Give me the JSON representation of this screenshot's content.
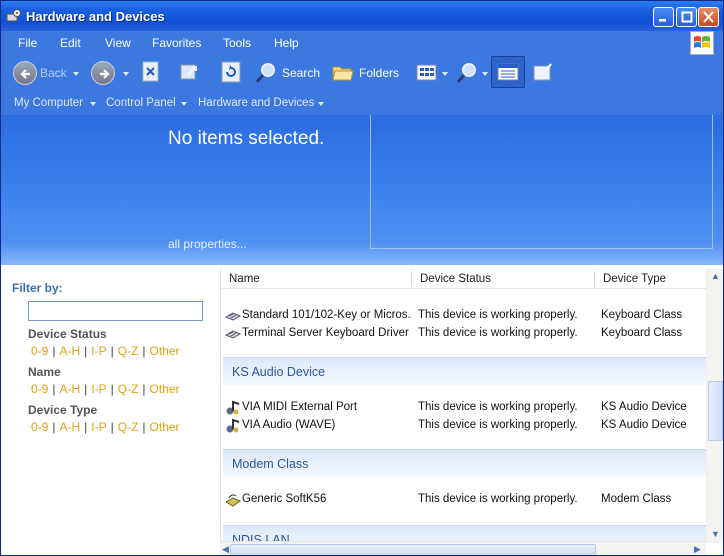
{
  "window": {
    "title": "Hardware and Devices"
  },
  "menu": [
    "File",
    "Edit",
    "View",
    "Favorites",
    "Tools",
    "Help"
  ],
  "toolbar": {
    "back_label": "Back",
    "search_label": "Search",
    "folders_label": "Folders"
  },
  "breadcrumb": [
    "My Computer",
    "Control Panel",
    "Hardware and Devices"
  ],
  "preview": {
    "headline": "No items selected.",
    "all_properties": "all properties..."
  },
  "filter": {
    "heading": "Filter by:",
    "groups": [
      {
        "title": "Device Status",
        "links": [
          "0-9",
          "A-H",
          "I-P",
          "Q-Z",
          "Other"
        ]
      },
      {
        "title": "Name",
        "links": [
          "0-9",
          "A-H",
          "I-P",
          "Q-Z",
          "Other"
        ]
      },
      {
        "title": "Device Type",
        "links": [
          "0-9",
          "A-H",
          "I-P",
          "Q-Z",
          "Other"
        ]
      }
    ]
  },
  "list": {
    "columns": [
      "Name",
      "Device Status",
      "Device Type"
    ],
    "rows": [
      {
        "name": "Standard 101/102-Key or Micros...",
        "status": "This device is working properly.",
        "type": "Keyboard Class",
        "icon": "keyboard-icon"
      },
      {
        "name": "Terminal Server Keyboard Driver",
        "status": "This device is working properly.",
        "type": "Keyboard Class",
        "icon": "keyboard-icon"
      },
      {
        "name": "VIA MIDI External Port",
        "status": "This device is working properly.",
        "type": "KS Audio Device",
        "icon": "audio-device-icon"
      },
      {
        "name": "VIA Audio (WAVE)",
        "status": "This device is working properly.",
        "type": "KS Audio Device",
        "icon": "audio-device-icon"
      },
      {
        "name": "Generic SoftK56",
        "status": "This device is working properly.",
        "type": "Modem Class",
        "icon": "modem-icon"
      }
    ],
    "groups": [
      "KS Audio Device",
      "Modem Class",
      "NDIS LAN"
    ]
  }
}
